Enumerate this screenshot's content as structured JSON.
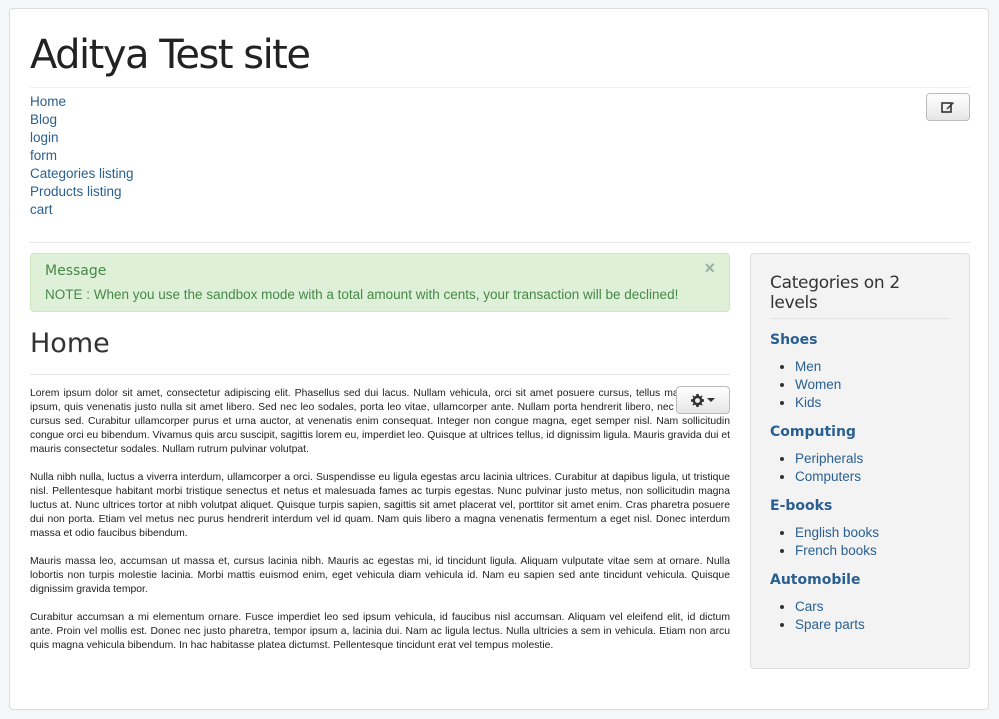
{
  "site": {
    "title": "Aditya Test site"
  },
  "nav": [
    "Home",
    "Blog",
    "login",
    "form",
    "Categories listing",
    "Products listing",
    "cart"
  ],
  "alert": {
    "heading": "Message",
    "text": "NOTE : When you use the sandbox mode with a total amount with cents, your transaction will be declined!",
    "close": "×"
  },
  "main": {
    "heading": "Home",
    "paragraphs": [
      "Lorem ipsum dolor sit amet, consectetur adipiscing elit. Phasellus sed dui lacus. Nullam vehicula, orci sit amet posuere cursus, tellus magna ornare ipsum, quis venenatis justo nulla sit amet libero. Sed nec leo sodales, porta leo vitae, ullamcorper ante. Nullam porta hendrerit libero, nec lobortis nisi cursus sed. Curabitur ullamcorper purus et urna auctor, at venenatis enim consequat. Integer non congue magna, eget semper nisl. Nam sollicitudin congue orci eu bibendum. Vivamus quis arcu suscipit, sagittis lorem eu, imperdiet leo. Quisque at ultrices tellus, id dignissim ligula. Mauris gravida dui et mauris consectetur sodales. Nullam rutrum pulvinar volutpat.",
      "Nulla nibh nulla, luctus a viverra interdum, ullamcorper a orci. Suspendisse eu ligula egestas arcu lacinia ultrices. Curabitur at dapibus ligula, ut tristique nisl. Pellentesque habitant morbi tristique senectus et netus et malesuada fames ac turpis egestas. Nunc pulvinar justo metus, non sollicitudin magna luctus at. Nunc ultrices tortor at nibh volutpat aliquet. Quisque turpis sapien, sagittis sit amet placerat vel, porttitor sit amet enim. Cras pharetra posuere dui non porta. Etiam vel metus nec purus hendrerit interdum vel id quam. Nam quis libero a magna venenatis fermentum a eget nisl. Donec interdum massa et odio faucibus bibendum.",
      "Mauris massa leo, accumsan ut massa et, cursus lacinia nibh. Mauris ac egestas mi, id tincidunt ligula. Aliquam vulputate vitae sem at ornare. Nulla lobortis non turpis molestie lacinia. Morbi mattis euismod enim, eget vehicula diam vehicula id. Nam eu sapien sed ante tincidunt vehicula. Quisque dignissim gravida tempor.",
      "Curabitur accumsan a mi elementum ornare. Fusce imperdiet leo sed ipsum vehicula, id faucibus nisl accumsan. Aliquam vel eleifend elit, id dictum ante. Proin vel mollis est. Donec nec justo pharetra, tempor ipsum a, lacinia dui. Nam ac ligula lectus. Nulla ultricies a sem in vehicula. Etiam non arcu quis magna vehicula bibendum. In hac habitasse platea dictumst. Pellentesque tincidunt erat vel tempus molestie."
    ]
  },
  "sidebar": {
    "title": "Categories on 2 levels",
    "categories": [
      {
        "name": "Shoes",
        "items": [
          "Men",
          "Women",
          "Kids"
        ]
      },
      {
        "name": "Computing",
        "items": [
          "Peripherals",
          "Computers"
        ]
      },
      {
        "name": "E-books",
        "items": [
          "English books",
          "French books"
        ]
      },
      {
        "name": "Automobile",
        "items": [
          "Cars",
          "Spare parts"
        ]
      }
    ]
  },
  "icons": {
    "edit": "edit-icon",
    "gear": "gear-icon",
    "caret": "caret-down-icon",
    "close": "close-icon"
  },
  "colors": {
    "link": "#2a5f91",
    "alert_bg": "#dff0d8",
    "alert_text": "#468847",
    "sidebar_bg": "#f3f3f3"
  }
}
